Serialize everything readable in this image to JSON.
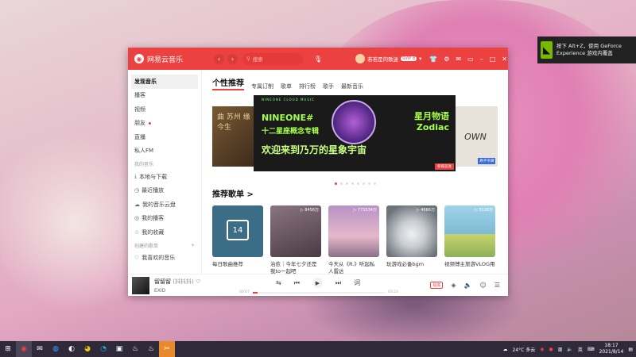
{
  "app": {
    "name": "网易云音乐",
    "logo_icon": "netease-music-icon"
  },
  "titlebar": {
    "search_placeholder": "搜索",
    "username": "若若是的歌迷",
    "vip": "SVIP 8"
  },
  "notification": {
    "text": "按下 Alt+Z，使用 GeForce Experience 游戏内覆盖"
  },
  "sidebar": {
    "top": [
      {
        "label": "发现音乐",
        "active": true
      },
      {
        "label": "播客"
      },
      {
        "label": "视频"
      },
      {
        "label": "朋友"
      },
      {
        "label": "直播"
      },
      {
        "label": "私人FM"
      }
    ],
    "my_music_header": "我的音乐",
    "my_music": [
      {
        "label": "本地与下载"
      },
      {
        "label": "最近播放"
      },
      {
        "label": "我的音乐云盘"
      },
      {
        "label": "我的播客"
      },
      {
        "label": "我的收藏"
      }
    ],
    "created_header": "创建的歌单",
    "created": [
      {
        "label": "我喜欢的音乐"
      }
    ]
  },
  "tabs": [
    {
      "label": "个性推荐",
      "active": true
    },
    {
      "label": "专属订制"
    },
    {
      "label": "歌单"
    },
    {
      "label": "排行榜"
    },
    {
      "label": "歌手"
    },
    {
      "label": "最新音乐"
    }
  ],
  "banner": {
    "left_text": "曲 苏州 缘 今生",
    "right_text": "OWN",
    "right_tag": "数字专辑",
    "top_line": "NINEONE CLOUD MUSIC",
    "line1": "NINEONE#",
    "line2": "十二星座概念专辑",
    "line3a": "星月物语",
    "line3b": "Zodiac",
    "line4": "欢迎来到乃万的星象宇宙",
    "badge": "新碟首发"
  },
  "recommend": {
    "title": "推荐歌单 >",
    "cards": [
      {
        "title": "每日歌曲推荐",
        "playcount": "",
        "calendar_day": "14",
        "color": "#3b6e86"
      },
      {
        "title": "治愈｜今年七夕还是我to一起吧",
        "playcount": "8456万",
        "color": "#6a5c66"
      },
      {
        "title": "今天从《R.》听起私人雷达",
        "playcount": "773534万",
        "color": "#caa6c4"
      },
      {
        "title": "玩游戏必备bgm",
        "playcount": "4686万",
        "color": "#9aa3ad"
      },
      {
        "title": "视频博主旅游VLOG用",
        "playcount": "3128万",
        "color": "#7dbbd4"
      }
    ]
  },
  "player": {
    "title": "留留留",
    "alt_title": "(抖抖抖)",
    "artist": "EXID",
    "elapsed": "00:07",
    "total": "03:23",
    "progress": 0.035,
    "quality": "极高"
  },
  "taskbar": {
    "weather": "24°C 多云",
    "time": "18:17",
    "date": "2021/8/14",
    "lang": "英"
  }
}
